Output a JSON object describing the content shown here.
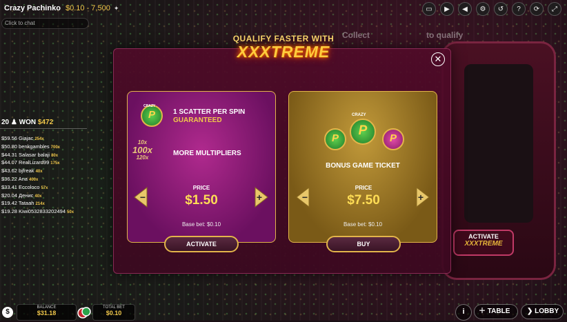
{
  "header": {
    "game_title": "Crazy Pachinko",
    "bet_range": "$0.10 - 7,500",
    "icons": [
      "chat-icon",
      "video-icon",
      "volume-icon",
      "settings-icon",
      "history-icon",
      "help-icon",
      "refresh-icon",
      "fullscreen-icon"
    ]
  },
  "chat": {
    "placeholder": "Click to chat"
  },
  "winners": {
    "count": "20",
    "won_label": "WON",
    "won_amount": "$472",
    "list": [
      {
        "amount": "$59.56",
        "name": "Giajac",
        "mult": "254x"
      },
      {
        "amount": "$50.80",
        "name": "benkgambles",
        "mult": "700x"
      },
      {
        "amount": "$44.31",
        "name": "Salasar balaji",
        "mult": "80x"
      },
      {
        "amount": "$44.07",
        "name": "RealLizard99",
        "mult": "175x"
      },
      {
        "amount": "$43.62",
        "name": "bjfreak",
        "mult": "40x"
      },
      {
        "amount": "$36.22",
        "name": "Ana",
        "mult": "400x"
      },
      {
        "amount": "$33.41",
        "name": "Eccoloco",
        "mult": "57x"
      },
      {
        "amount": "$20.04",
        "name": "Денис",
        "mult": "40x"
      },
      {
        "amount": "$19.42",
        "name": "Tataah",
        "mult": "214x"
      },
      {
        "amount": "$19.28",
        "name": "Kiwi0532833202494",
        "mult": "50x"
      }
    ]
  },
  "background": {
    "collect_text": "Collect",
    "to_qualify_text": "to qualify",
    "machine_activate": "ACTIVATE",
    "machine_xxxtreme": "XXXTREME"
  },
  "modal": {
    "headline": "QUALIFY FASTER WITH",
    "brand": "XXXTREME",
    "left_card": {
      "badge_text": "CRAZY",
      "feature1_line1": "1 SCATTER PER SPIN",
      "feature1_line2": "GUARANTEED",
      "mult_a": "10x",
      "mult_b": "100x",
      "mult_c": "120x",
      "feature2": "MORE MULTIPLIERS",
      "price_label": "PRICE",
      "price": "$1.50",
      "base_bet": "Base bet: $0.10",
      "button": "ACTIVATE"
    },
    "right_card": {
      "badge_text": "CRAZY",
      "feature": "BONUS GAME TICKET",
      "price_label": "PRICE",
      "price": "$7.50",
      "base_bet": "Base bet: $0.10",
      "button": "BUY"
    }
  },
  "footer": {
    "balance_label": "BALANCE",
    "balance_value": "$31.18",
    "total_bet_label": "TOTAL BET",
    "total_bet_value": "$0.10",
    "table_label": "TABLE",
    "lobby_label": "LOBBY"
  }
}
